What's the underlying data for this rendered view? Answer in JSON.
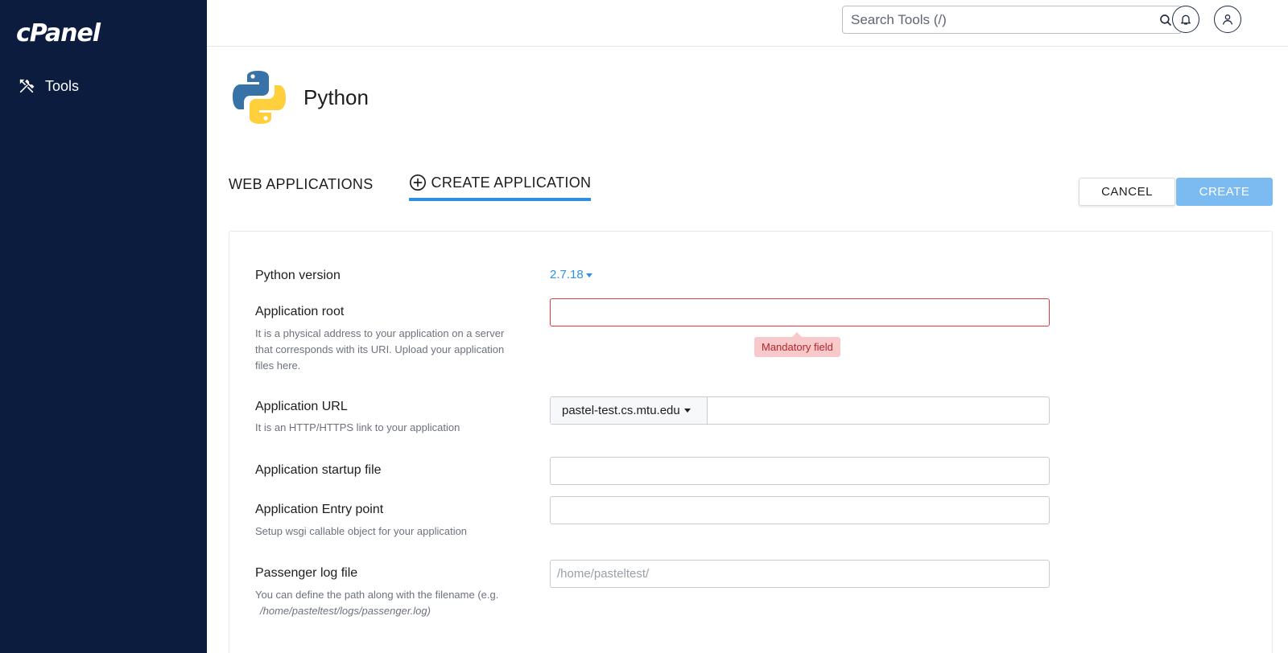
{
  "sidebar": {
    "logo": "cPanel",
    "items": [
      {
        "label": "Tools",
        "icon": "tools-icon"
      }
    ]
  },
  "header": {
    "search_placeholder": "Search Tools (/)",
    "icons": [
      "search-icon",
      "bell-icon",
      "user-icon"
    ]
  },
  "app": {
    "title": "Python",
    "icon": "python-logo-icon"
  },
  "tabs": [
    {
      "label": "WEB APPLICATIONS",
      "active": false
    },
    {
      "label": "CREATE APPLICATION",
      "active": true,
      "icon": "plus-circle-icon"
    }
  ],
  "actions": {
    "cancel_label": "CANCEL",
    "create_label": "CREATE"
  },
  "form": {
    "python_version": {
      "label": "Python version",
      "value": "2.7.18"
    },
    "app_root": {
      "label": "Application root",
      "help": "It is a physical address to your application on a server that corresponds with its URI. Upload your application files here.",
      "value": "",
      "error": "Mandatory field"
    },
    "app_url": {
      "label": "Application URL",
      "help": "It is an HTTP/HTTPS link to your application",
      "domain": "pastel-test.cs.mtu.edu",
      "value": ""
    },
    "startup_file": {
      "label": "Application startup file",
      "value": ""
    },
    "entry_point": {
      "label": "Application Entry point",
      "help": "Setup wsgi callable object for your application",
      "value": ""
    },
    "log_file": {
      "label": "Passenger log file",
      "help": "You can define the path along with the filename (e.g.",
      "help_example": "/home/pasteltest/logs/passenger.log)",
      "placeholder": "/home/pasteltest/",
      "value": ""
    }
  },
  "colors": {
    "sidebar_bg": "#0b1c3f",
    "accent": "#2f8ee5",
    "create_button": "#7cbbf2",
    "error_border": "#e0393e",
    "error_tooltip_bg": "#f7c9cb"
  }
}
